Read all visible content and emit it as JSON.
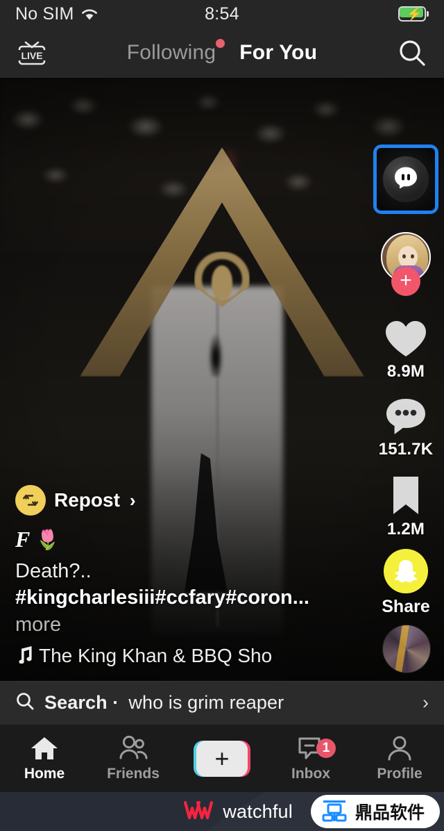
{
  "status_bar": {
    "carrier": "No SIM",
    "wifi_icon": "wifi-icon",
    "time": "8:54",
    "battery_icon": "battery-charging-icon"
  },
  "top_nav": {
    "live_label": "LIVE",
    "live_icon": "live-tv-icon",
    "tabs": [
      {
        "label": "Following",
        "active": false,
        "has_badge": true
      },
      {
        "label": "For You",
        "active": true,
        "has_badge": false
      }
    ],
    "search_icon": "search-icon"
  },
  "action_rail": {
    "effect_button": {
      "icon": "ghost-bubble-icon",
      "focused": true,
      "focus_color": "#1f82f0"
    },
    "avatar": {
      "name": "creator-avatar",
      "follow_icon": "plus-icon",
      "follow_color": "#f2566a"
    },
    "like": {
      "icon": "heart-icon",
      "count": "8.9M"
    },
    "comment": {
      "icon": "comment-icon",
      "count": "151.7K"
    },
    "save": {
      "icon": "bookmark-icon",
      "count": "1.2M"
    },
    "share": {
      "icon": "snapchat-icon",
      "label": "Share",
      "color": "#f5f03c"
    },
    "music_disc": "music-disc-icon"
  },
  "post": {
    "repost_label": "Repost",
    "repost_icon": "repost-icon",
    "repost_chevron": "›",
    "username_glyph": "F",
    "username_emoji": "🌷",
    "caption": "Death?..",
    "hashtags": "#kingcharlesiii#ccfary#coron...",
    "more_label": " more",
    "music_icon": "music-note-icon",
    "music_title": "The King Khan & BBQ Sho"
  },
  "search_suggestion": {
    "icon": "search-icon",
    "label": "Search ·",
    "query": "who is grim reaper",
    "chevron": "›"
  },
  "bottom_nav": {
    "items": [
      {
        "label": "Home",
        "icon": "home-icon",
        "active": true
      },
      {
        "label": "Friends",
        "icon": "friends-icon",
        "active": false
      },
      {
        "label": "",
        "icon": "create-plus-icon",
        "active": false
      },
      {
        "label": "Inbox",
        "icon": "inbox-icon",
        "active": false,
        "badge": "1"
      },
      {
        "label": "Profile",
        "icon": "profile-icon",
        "active": false
      }
    ],
    "create_plus": "+"
  },
  "footer_watermark": {
    "brand_icon": "watchful-logo-icon",
    "brand": "watchful",
    "partner_icon": "dingpin-logo-icon",
    "partner": "鼎品软件"
  }
}
